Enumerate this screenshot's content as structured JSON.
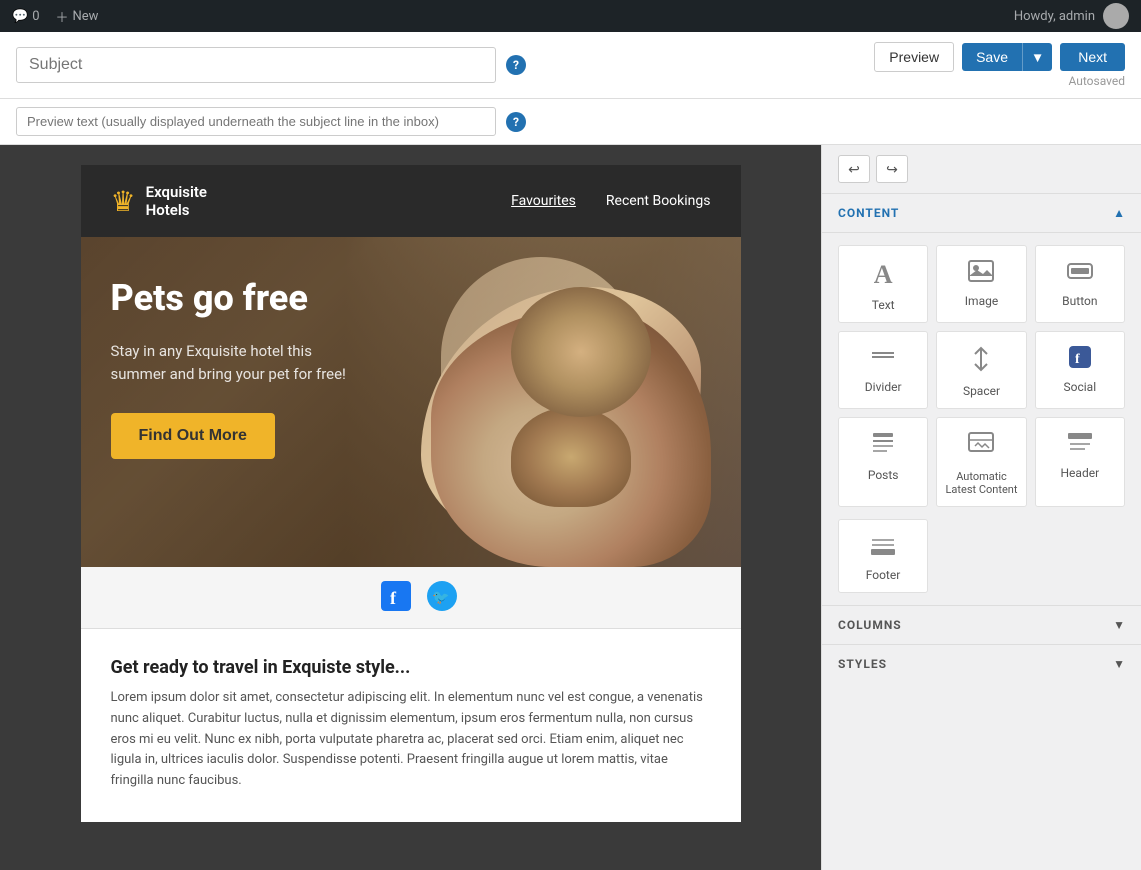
{
  "admin_bar": {
    "comment_count": "0",
    "new_label": "New",
    "user_label": "Howdy, admin"
  },
  "toolbar": {
    "subject_placeholder": "Subject",
    "preview_label": "Preview",
    "save_label": "Save",
    "next_label": "Next",
    "autosaved_label": "Autosaved"
  },
  "preview_text": {
    "placeholder": "Preview text (usually displayed underneath the subject line in the inbox)"
  },
  "email": {
    "brand_name": "Exquisite\nHotels",
    "nav": [
      "Favourites",
      "Recent Bookings"
    ],
    "hero_title": "Pets go free",
    "hero_text": "Stay in any Exquisite hotel this summer and bring your pet for free!",
    "hero_cta": "Find Out More",
    "social_icons": [
      "facebook",
      "twitter"
    ],
    "body_title": "Get ready to travel in Exquiste style...",
    "body_text": "Lorem ipsum dolor sit amet, consectetur adipiscing elit. In elementum nunc vel est congue, a venenatis nunc aliquet. Curabitur luctus, nulla et dignissim elementum, ipsum eros fermentum nulla, non cursus eros mi eu velit. Nunc ex nibh, porta vulputate pharetra ac, placerat sed orci. Etiam enim, aliquet nec ligula in, ultrices iaculis dolor. Suspendisse potenti. Praesent fringilla augue ut lorem mattis, vitae fringilla nunc faucibus."
  },
  "sidebar": {
    "undo_symbol": "↩",
    "redo_symbol": "↪",
    "content_title": "CONTENT",
    "content_items": [
      {
        "label": "Text",
        "icon": "A"
      },
      {
        "label": "Image",
        "icon": "🖼"
      },
      {
        "label": "Button",
        "icon": "👆"
      },
      {
        "label": "Divider",
        "icon": "—"
      },
      {
        "label": "Spacer",
        "icon": "↕"
      },
      {
        "label": "Social",
        "icon": "f"
      },
      {
        "label": "Posts",
        "icon": "📄"
      },
      {
        "label": "Automatic Latest Content",
        "icon": "🔄"
      },
      {
        "label": "Header",
        "icon": "▤"
      },
      {
        "label": "Footer",
        "icon": "▬"
      }
    ],
    "columns_title": "COLUMNS",
    "styles_title": "STYLES"
  }
}
